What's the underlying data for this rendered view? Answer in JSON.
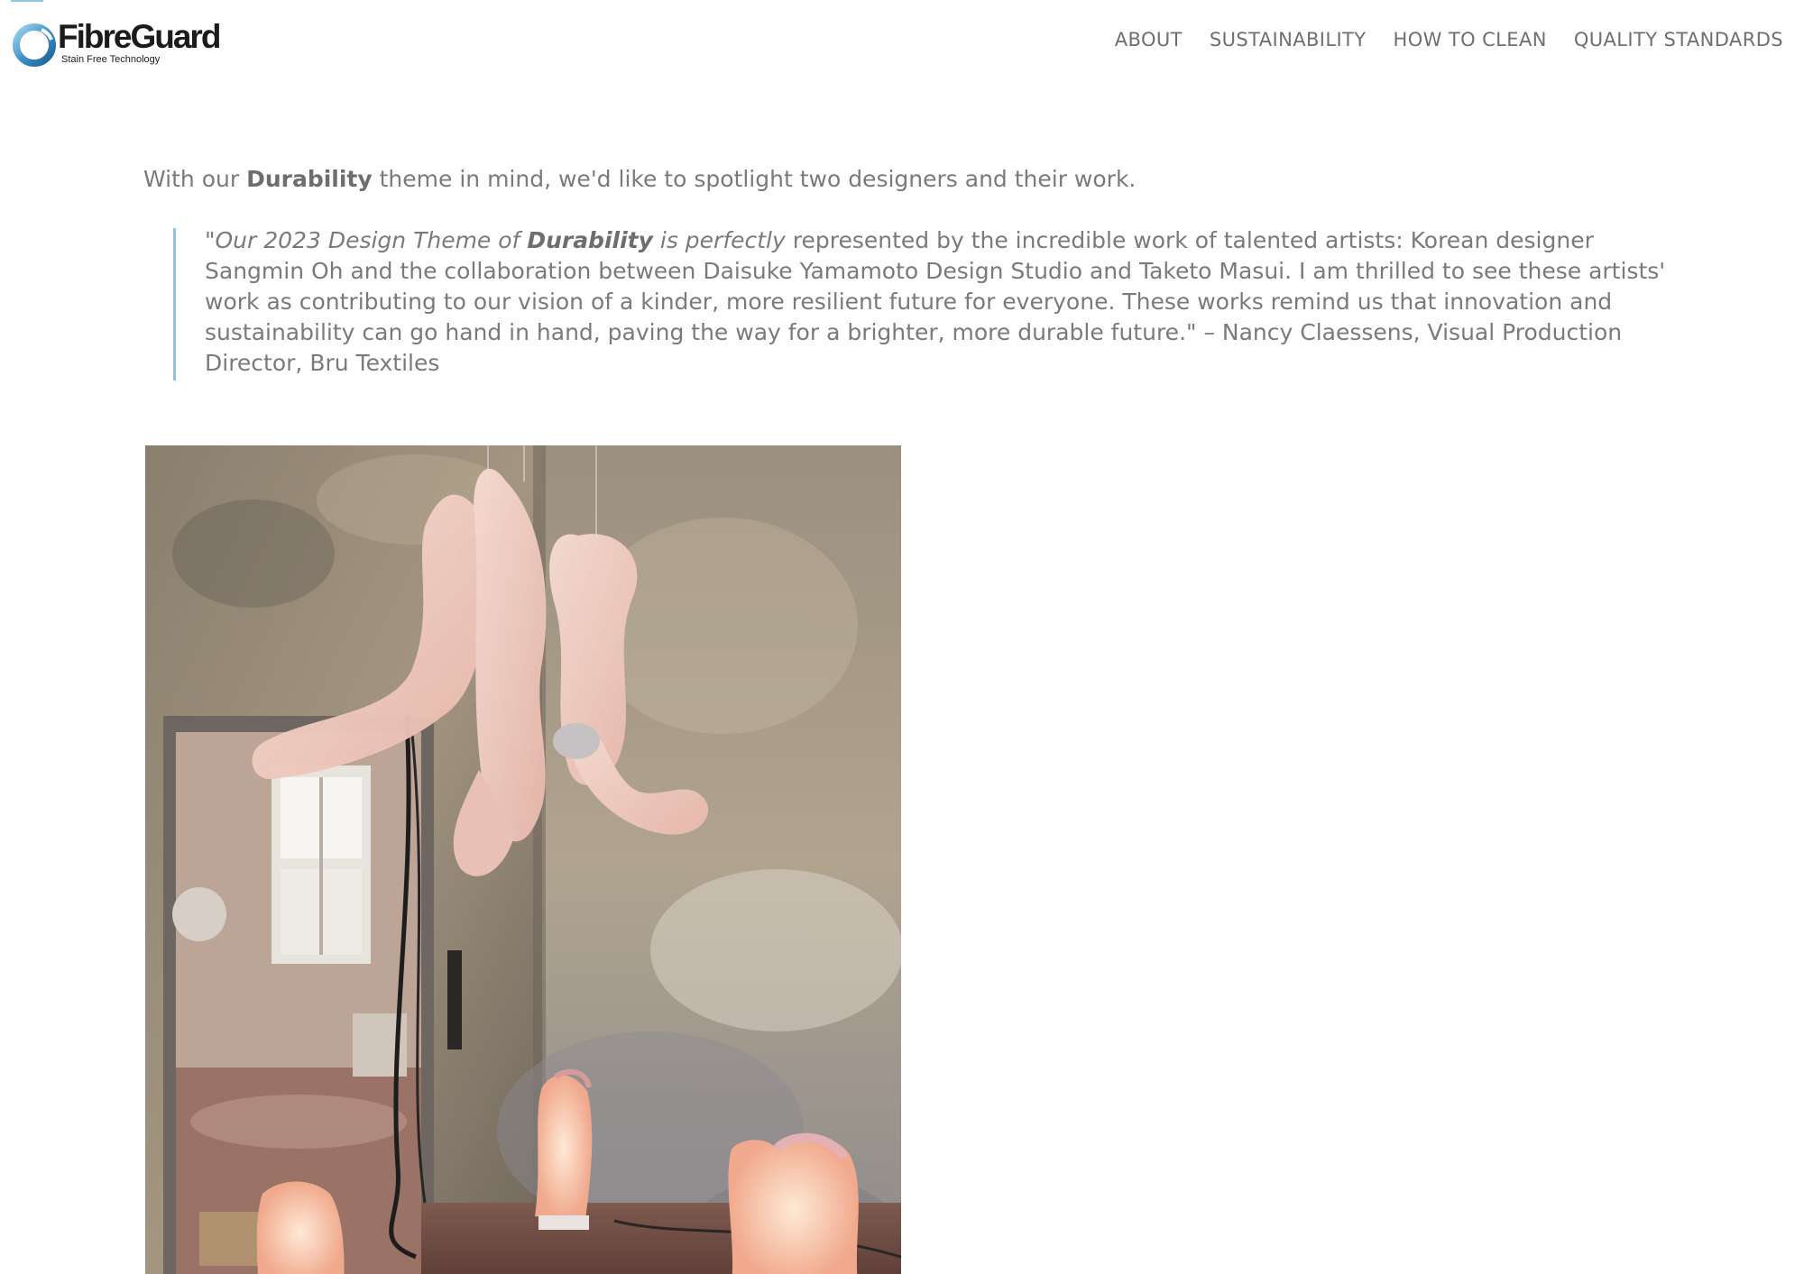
{
  "header": {
    "logo": {
      "name": "FibreGuard",
      "tagline": "Stain Free Technology",
      "icon": "fibreguard-ring-icon"
    },
    "nav": [
      {
        "label": "ABOUT"
      },
      {
        "label": "SUSTAINABILITY"
      },
      {
        "label": "HOW TO CLEAN"
      },
      {
        "label": "QUALITY STANDARDS"
      }
    ]
  },
  "article": {
    "intro": {
      "before": "With our ",
      "bold": "Durability",
      "after": " theme in mind, we'd like to spotlight two designers and their work."
    },
    "quote": {
      "italic_start": "\"Our 2023 Design Theme of ",
      "italic_bold": "Durability",
      "italic_end": " is perfectly",
      "rest": " represented by the incredible work of talented artists: Korean designer Sangmin Oh and the collaboration between Daisuke Yamamoto Design Studio and Taketo Masui. I am thrilled to see these artists' work as contributing to our vision of a kinder, more resilient future for everyone. These works remind us that innovation and sustainability can go hand in hand, paving the way for a brighter, more durable future.\" – Nancy Claessens, Visual Production Director, Bru Textiles"
    },
    "image": {
      "subject": "sculptural-installation-photo"
    }
  },
  "colors": {
    "accent": "#8cc6dd",
    "text": "#7a7a7a",
    "logo_ring": "#3a8fc4"
  }
}
